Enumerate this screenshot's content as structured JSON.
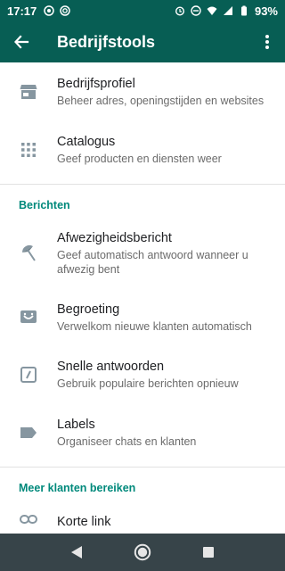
{
  "status_bar": {
    "time": "17:17",
    "battery": "93%"
  },
  "app_bar": {
    "title": "Bedrijfstools"
  },
  "items_top": [
    {
      "title": "Bedrijfsprofiel",
      "subtitle": "Beheer adres, openingstijden en websites",
      "icon": "store-icon"
    },
    {
      "title": "Catalogus",
      "subtitle": "Geef producten en diensten weer",
      "icon": "grid-icon"
    }
  ],
  "section_messages": {
    "header": "Berichten",
    "items": [
      {
        "title": "Afwezigheidsbericht",
        "subtitle": "Geef automatisch antwoord wanneer u afwezig bent",
        "icon": "beach-umbrella-icon"
      },
      {
        "title": "Begroeting",
        "subtitle": "Verwelkom nieuwe klanten automatisch",
        "icon": "greeting-icon"
      },
      {
        "title": "Snelle antwoorden",
        "subtitle": "Gebruik populaire berichten opnieuw",
        "icon": "quick-reply-icon"
      },
      {
        "title": "Labels",
        "subtitle": "Organiseer chats en klanten",
        "icon": "label-icon"
      }
    ]
  },
  "section_reach": {
    "header": "Meer klanten bereiken",
    "items": [
      {
        "title": "Korte link",
        "icon": "link-icon"
      }
    ]
  },
  "colors": {
    "primary_dark": "#075e54",
    "accent": "#00897b",
    "icon_gray": "#8696a0",
    "nav_bar": "#374449"
  }
}
